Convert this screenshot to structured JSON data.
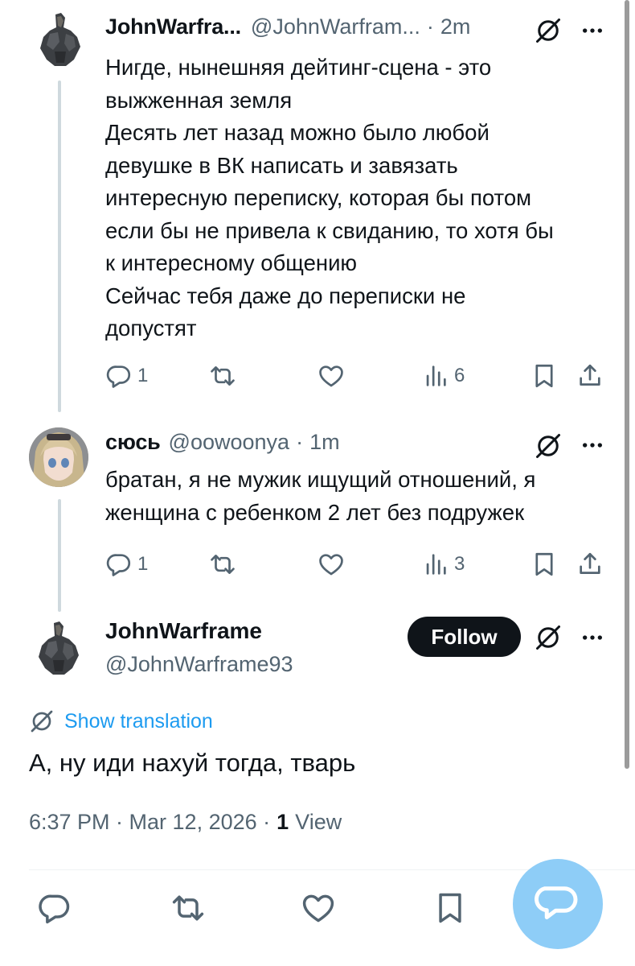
{
  "tweets": [
    {
      "name": "JohnWarfra...",
      "handle": "@JohnWarfram...",
      "time": "2m",
      "lines": [
        "Нигде, нынешняя дейтинг-сцена - это",
        "выжженная земля",
        "Десять лет назад можно было любой",
        "девушке в ВК написать и завязать",
        "интересную переписку, которая бы потом",
        "если бы не привела к свиданию, то хотя бы",
        "к интересному общению",
        "Сейчас тебя даже до переписки не",
        "допустят"
      ],
      "replies": "1",
      "views": "6"
    },
    {
      "name": "сюсь",
      "handle": "@oowoonya",
      "time": "1m",
      "lines": [
        "братан, я не мужик ищущий отношений, я",
        "женщина с ребенком 2 лет без подружек"
      ],
      "replies": "1",
      "views": "3"
    }
  ],
  "focus": {
    "name": "JohnWarframe",
    "handle": "@JohnWarframe93",
    "follow_label": "Follow",
    "translate_label": "Show translation",
    "text": "А, ну иди нахуй тогда, тварь",
    "timestamp": "6:37 PM · Mar 12, 2026 ·",
    "view_count": "1",
    "view_label": "View"
  },
  "colors": {
    "text": "#0f1419",
    "secondary": "#536471",
    "accent": "#1d9bf0",
    "follow_bg": "#0f1419",
    "fab_bg": "#8ecdf7",
    "thread_line": "#cfd9de"
  },
  "icons": [
    "reply-icon",
    "retweet-icon",
    "like-icon",
    "views-icon",
    "bookmark-icon",
    "share-icon",
    "grok-icon",
    "more-icon",
    "translate-icon",
    "compose-message-icon"
  ]
}
